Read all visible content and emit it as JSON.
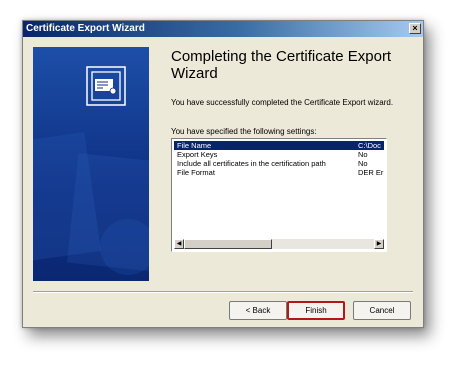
{
  "window": {
    "title": "Certificate Export Wizard",
    "close_glyph": "×"
  },
  "heading": "Completing the Certificate Export Wizard",
  "description": "You have successfully completed the Certificate Export wizard.",
  "settings_label": "You have specified the following settings:",
  "settings": [
    {
      "name": "File Name",
      "value": "C:\\Doc"
    },
    {
      "name": "Export Keys",
      "value": "No"
    },
    {
      "name": "Include all certificates in the certification path",
      "value": "No"
    },
    {
      "name": "File Format",
      "value": "DER Er"
    }
  ],
  "scroll": {
    "left_arrow": "◀",
    "right_arrow": "▶"
  },
  "buttons": {
    "back": "< Back",
    "finish": "Finish",
    "cancel": "Cancel"
  },
  "icons": {
    "banner": "certificate-icon",
    "close": "close-icon"
  },
  "colors": {
    "banner": "#0d2f82",
    "selection": "#0a246a",
    "finish_highlight": "#b4161b"
  }
}
